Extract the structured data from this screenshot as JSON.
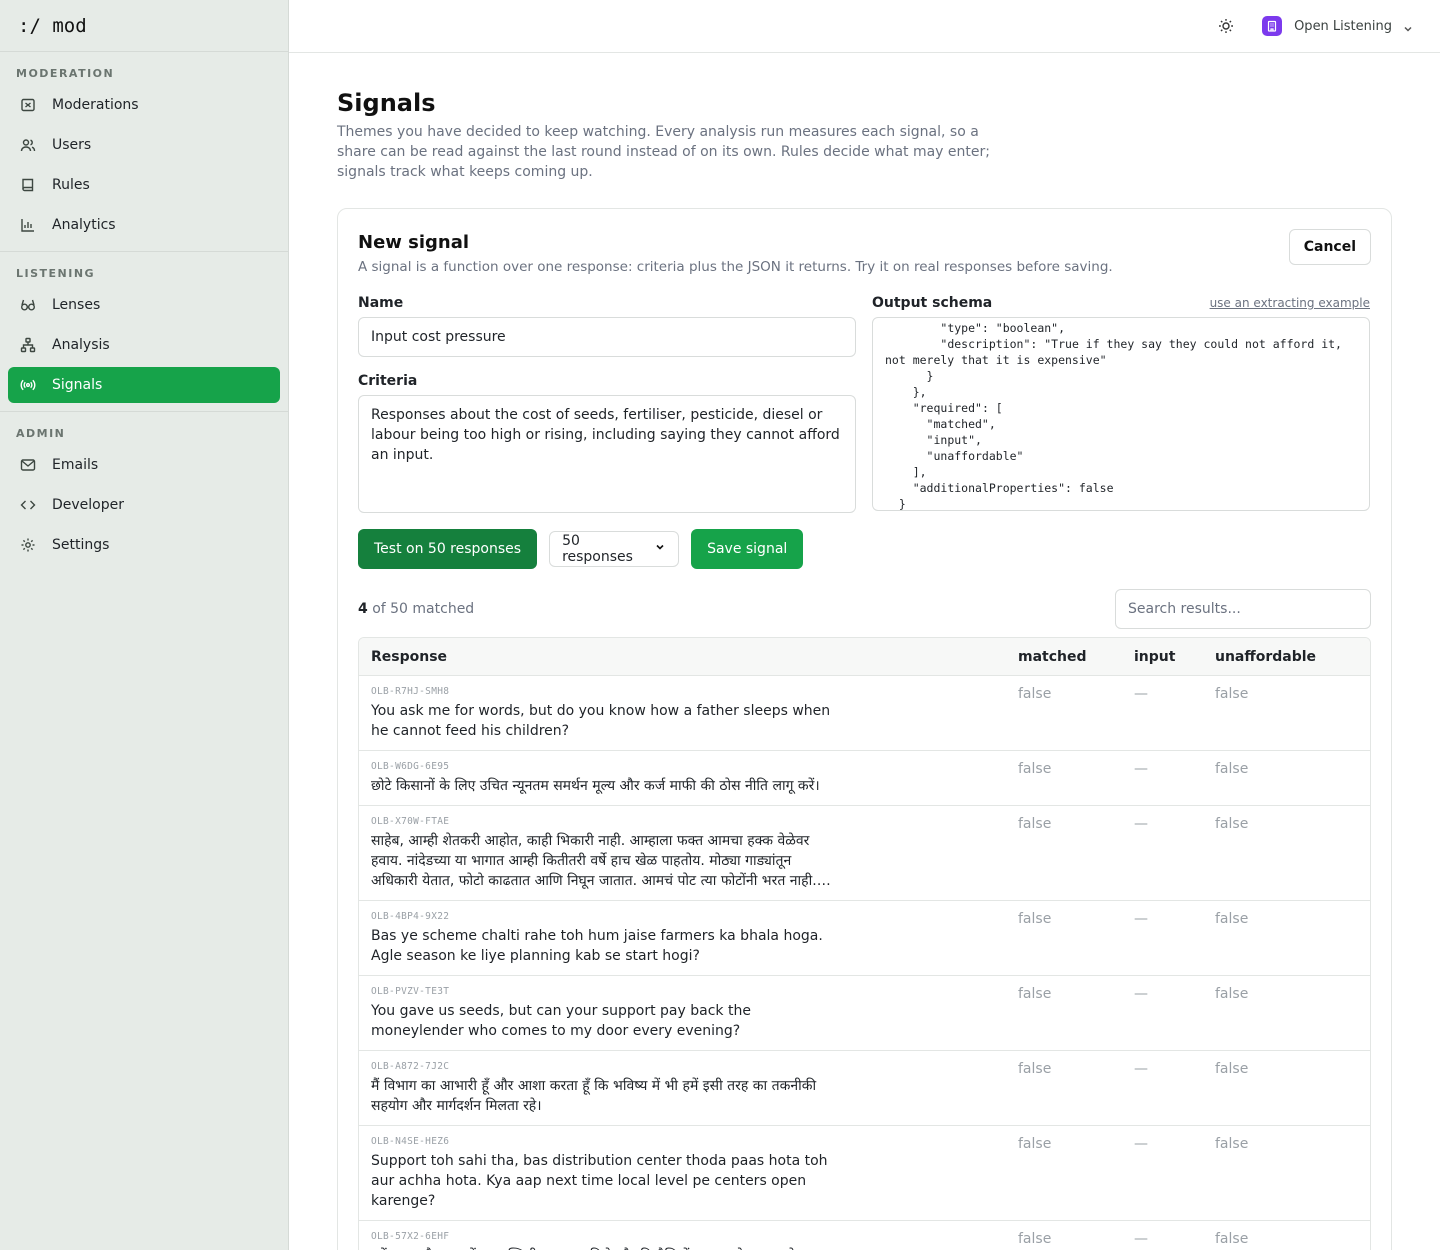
{
  "brand": ":/ mod",
  "sidebar": {
    "sections": [
      {
        "heading": "MODERATION",
        "items": [
          {
            "label": "Moderations",
            "icon": "flag-icon"
          },
          {
            "label": "Users",
            "icon": "users-icon"
          },
          {
            "label": "Rules",
            "icon": "book-icon"
          },
          {
            "label": "Analytics",
            "icon": "chart-icon"
          }
        ]
      },
      {
        "heading": "LISTENING",
        "items": [
          {
            "label": "Lenses",
            "icon": "glasses-icon"
          },
          {
            "label": "Analysis",
            "icon": "hierarchy-icon"
          },
          {
            "label": "Signals",
            "icon": "broadcast-icon",
            "active": true
          }
        ]
      },
      {
        "heading": "ADMIN",
        "items": [
          {
            "label": "Emails",
            "icon": "mail-icon"
          },
          {
            "label": "Developer",
            "icon": "code-icon"
          },
          {
            "label": "Settings",
            "icon": "gear-icon"
          }
        ]
      }
    ]
  },
  "topbar": {
    "org_name": "Open Listening",
    "theme_icon": "sun-icon",
    "org_icon": "building-icon",
    "accent": "#7c3aed"
  },
  "page": {
    "title": "Signals",
    "description": "Themes you have decided to keep watching. Every analysis run measures each signal, so a share can be read against the last round instead of on its own. Rules decide what may enter; signals track what keeps coming up."
  },
  "form": {
    "title": "New signal",
    "subtitle": "A signal is a function over one response: criteria plus the JSON it returns. Try it on real responses before saving.",
    "cancel_label": "Cancel",
    "name_label": "Name",
    "name_value": "Input cost pressure",
    "criteria_label": "Criteria",
    "criteria_value": "Responses about the cost of seeds, fertiliser, pesticide, diesel or labour being too high or rising, including saying they cannot afford an input.",
    "schema_label": "Output schema",
    "schema_link": "use an extracting example",
    "schema_value": "        \"type\": \"boolean\",\n        \"description\": \"True if they say they could not afford it, not merely that it is expensive\"\n      }\n    },\n    \"required\": [\n      \"matched\",\n      \"input\",\n      \"unaffordable\"\n    ],\n    \"additionalProperties\": false\n  }",
    "test_label": "Test on 50 responses",
    "sample_select": "50 responses",
    "save_label": "Save signal"
  },
  "results": {
    "matched_count": "4",
    "matched_suffix": "of 50 matched",
    "search_placeholder": "Search results...",
    "columns": [
      "Response",
      "matched",
      "input",
      "unaffordable"
    ],
    "rows": [
      {
        "id": "OLB-R7HJ-SMH8",
        "text": "You ask me for words, but do you know how a father sleeps when he cannot feed his children?",
        "matched": "false",
        "input": "—",
        "unaffordable": "false"
      },
      {
        "id": "OLB-W6DG-6E95",
        "text": "छोटे किसानों के लिए उचित न्यूनतम समर्थन मूल्य और कर्ज माफी की ठोस नीति लागू करें।",
        "matched": "false",
        "input": "—",
        "unaffordable": "false"
      },
      {
        "id": "OLB-X70W-FTAE",
        "text": "साहेब, आम्ही शेतकरी आहोत, काही भिकारी नाही. आम्हाला फक्त आमचा हक्क वेळेवर हवाय. नांदेडच्या या भागात आम्ही कितीतरी वर्षे हाच खेळ पाहतोय. मोठ्या गाड्यांतून अधिकारी येतात, फोटो काढतात आणि निघून जातात. आमचं पोट त्या फोटोंनी भरत नाही. आता तरी काहीतरी ठोस...",
        "matched": "false",
        "input": "—",
        "unaffordable": "false"
      },
      {
        "id": "OLB-4BP4-9X22",
        "text": "Bas ye scheme chalti rahe toh hum jaise farmers ka bhala hoga. Agle season ke liye planning kab se start hogi?",
        "matched": "false",
        "input": "—",
        "unaffordable": "false"
      },
      {
        "id": "OLB-PVZV-TE3T",
        "text": "You gave us seeds, but can your support pay back the moneylender who comes to my door every evening?",
        "matched": "false",
        "input": "—",
        "unaffordable": "false"
      },
      {
        "id": "OLB-A872-7J2C",
        "text": "मैं विभाग का आभारी हूँ और आशा करता हूँ कि भविष्य में भी हमें इसी तरह का तकनीकी सहयोग और मार्गदर्शन मिलता रहे।",
        "matched": "false",
        "input": "—",
        "unaffordable": "false"
      },
      {
        "id": "OLB-N4SE-HEZ6",
        "text": "Support toh sahi tha, bas distribution center thoda paas hota toh aur achha hota. Kya aap next time local level pe centers open karenge?",
        "matched": "false",
        "input": "—",
        "unaffordable": "false"
      },
      {
        "id": "OLB-57X2-6EHF",
        "text": "हमें खाद और दवाओं पर सब्सिडी समय पर मिले और बिचौलियों का हस्तक्षेप खत्म हो।",
        "matched": "false",
        "input": "—",
        "unaffordable": "false"
      }
    ]
  }
}
